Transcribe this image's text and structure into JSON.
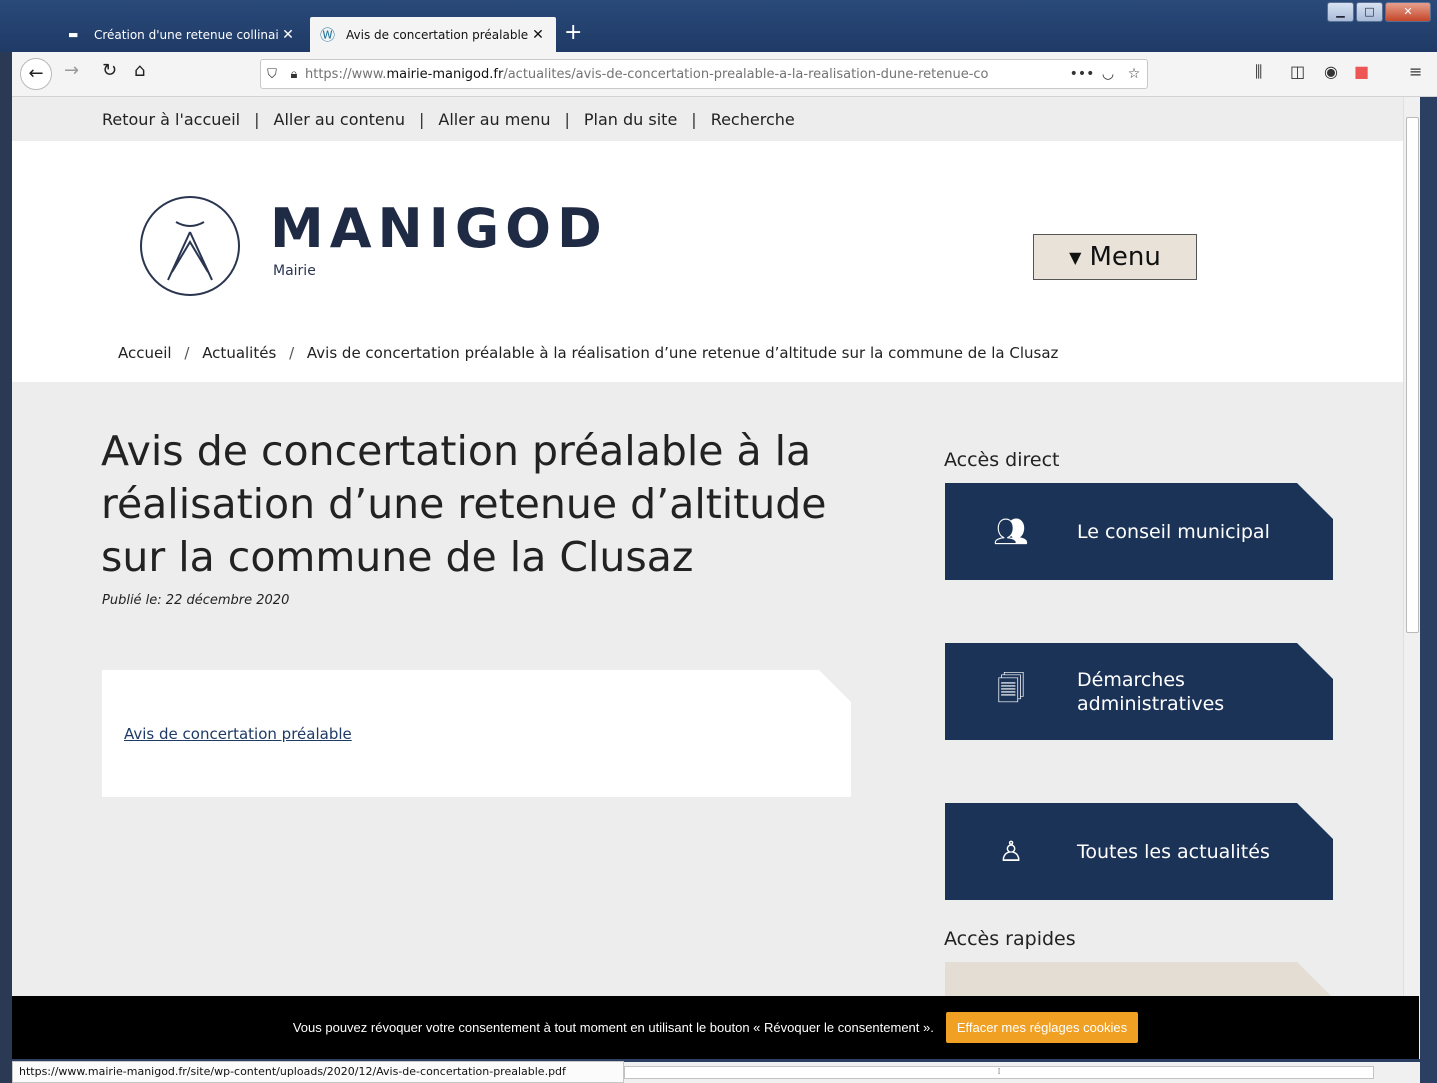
{
  "browser": {
    "tabs": [
      {
        "label": "Création d'une retenue collinai",
        "active": false
      },
      {
        "label": "Avis de concertation préalable",
        "active": true
      }
    ],
    "url_prefix": "https://www.",
    "url_domain": "mairie-manigod.fr",
    "url_path": "/actualites/avis-de-concertation-prealable-a-la-realisation-dune-retenue-co",
    "status_url": "https://www.mairie-manigod.fr/site/wp-content/uploads/2020/12/Avis-de-concertation-prealable.pdf"
  },
  "skiplinks": [
    "Retour à l'accueil",
    "Aller au contenu",
    "Aller au menu",
    "Plan du site",
    "Recherche"
  ],
  "skip_sep": "|",
  "header": {
    "logo_title": "MANIGOD",
    "logo_sub": "Mairie",
    "menu_label": "Menu"
  },
  "breadcrumb": {
    "home": "Accueil",
    "section": "Actualités",
    "current": "Avis de concertation préalable à la réalisation d’une retenue d’altitude sur la commune de la Clusaz",
    "sep": "/"
  },
  "article": {
    "title": "Avis de concertation préalable à la réalisation d’une retenue d’altitude sur la commune de la Clusaz",
    "published": "Publié le: 22 décembre 2020",
    "link_label": "Avis de concertation préalable"
  },
  "aside": {
    "direct_title": "Accès direct",
    "tiles": [
      {
        "label": "Le conseil municipal",
        "icon": "group-people-icon"
      },
      {
        "label": "Démarches administratives",
        "icon": "documents-icon"
      },
      {
        "label": "Toutes les actualités",
        "icon": "reader-icon"
      }
    ],
    "rapid_title": "Accès rapides"
  },
  "cookie": {
    "text": "Vous pouvez révoquer votre consentement à tout moment en utilisant le bouton « Révoquer le consentement ».",
    "button": "Effacer mes réglages cookies"
  },
  "colors": {
    "tile_bg": "#1c3358",
    "cookie_button": "#f0a022",
    "menu_button": "#e8e2d9"
  }
}
